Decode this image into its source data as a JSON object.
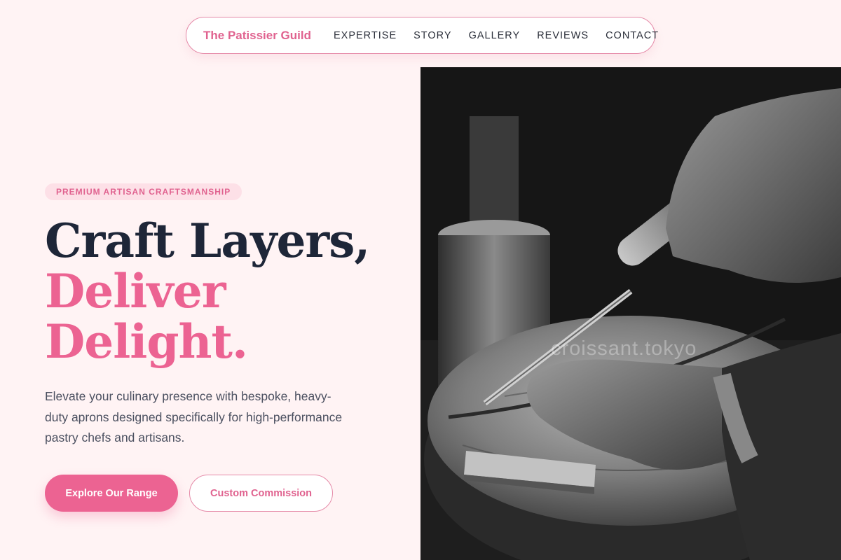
{
  "nav": {
    "brand": "The Patissier Guild",
    "links": [
      "EXPERTISE",
      "STORY",
      "GALLERY",
      "REVIEWS",
      "CONTACT"
    ]
  },
  "hero": {
    "badge": "PREMIUM ARTISAN CRAFTSMANSHIP",
    "headline": {
      "line1": "Craft Layers,",
      "line2": "Deliver",
      "line3": "Delight."
    },
    "description": "Elevate your culinary presence with bespoke, heavy-duty aprons designed specifically for high-performance pastry chefs and artisans.",
    "primary_cta": "Explore Our Range",
    "secondary_cta": "Custom Commission"
  },
  "image": {
    "watermark": "croissant.tokyo"
  },
  "colors": {
    "accent": "#ec6392",
    "brand": "#e0628f",
    "background": "#fff3f4",
    "heading": "#1e2638",
    "badge_bg": "#fde0e7"
  }
}
